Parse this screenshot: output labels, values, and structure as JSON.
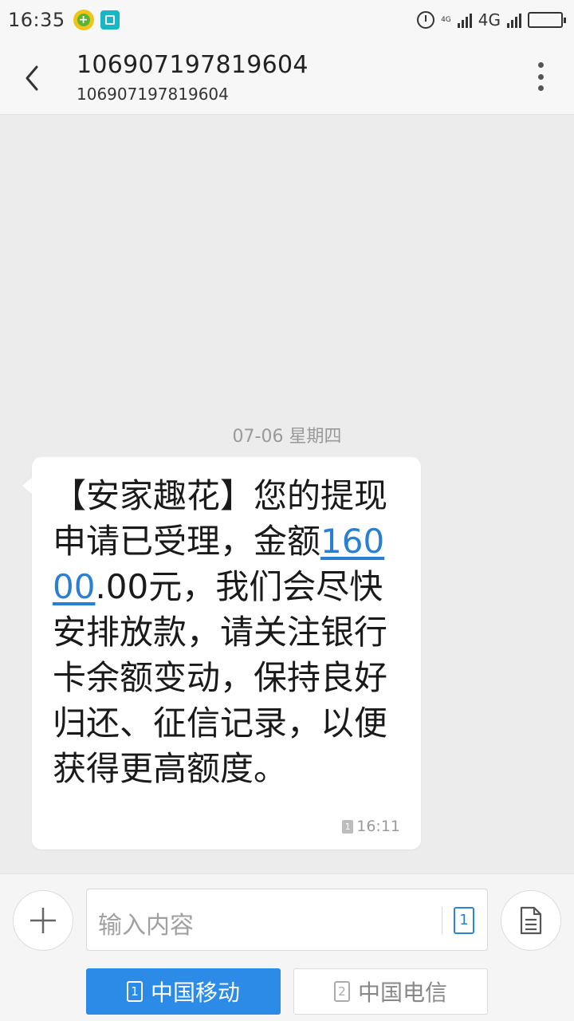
{
  "status_bar": {
    "time": "16:35",
    "tiny_network": "4G",
    "network": "4G",
    "icons": [
      "green-plus-app-icon",
      "teal-scan-app-icon",
      "alarm-icon",
      "signal-icon",
      "battery-icon"
    ]
  },
  "header": {
    "title": "106907197819604",
    "subtitle": "106907197819604"
  },
  "conversation": {
    "date_label": "07-06  星期四",
    "message": {
      "text_before": "【安家趣花】您的提现申请已受理，金额",
      "amount": "16000",
      "text_after": ".00元，我们会尽快安排放款，请关注银行卡余额变动，保持良好归还、征信记录，以便获得更高额度。",
      "sim_badge": "1",
      "time": "16:11"
    }
  },
  "composer": {
    "placeholder": "输入内容",
    "sim_indicator": "1",
    "sim_buttons": [
      {
        "number": "1",
        "label": "中国移动",
        "active": true
      },
      {
        "number": "2",
        "label": "中国电信",
        "active": false
      }
    ]
  },
  "colors": {
    "accent": "#2b8be6",
    "link": "#2a7fd0",
    "background": "#ececec"
  }
}
